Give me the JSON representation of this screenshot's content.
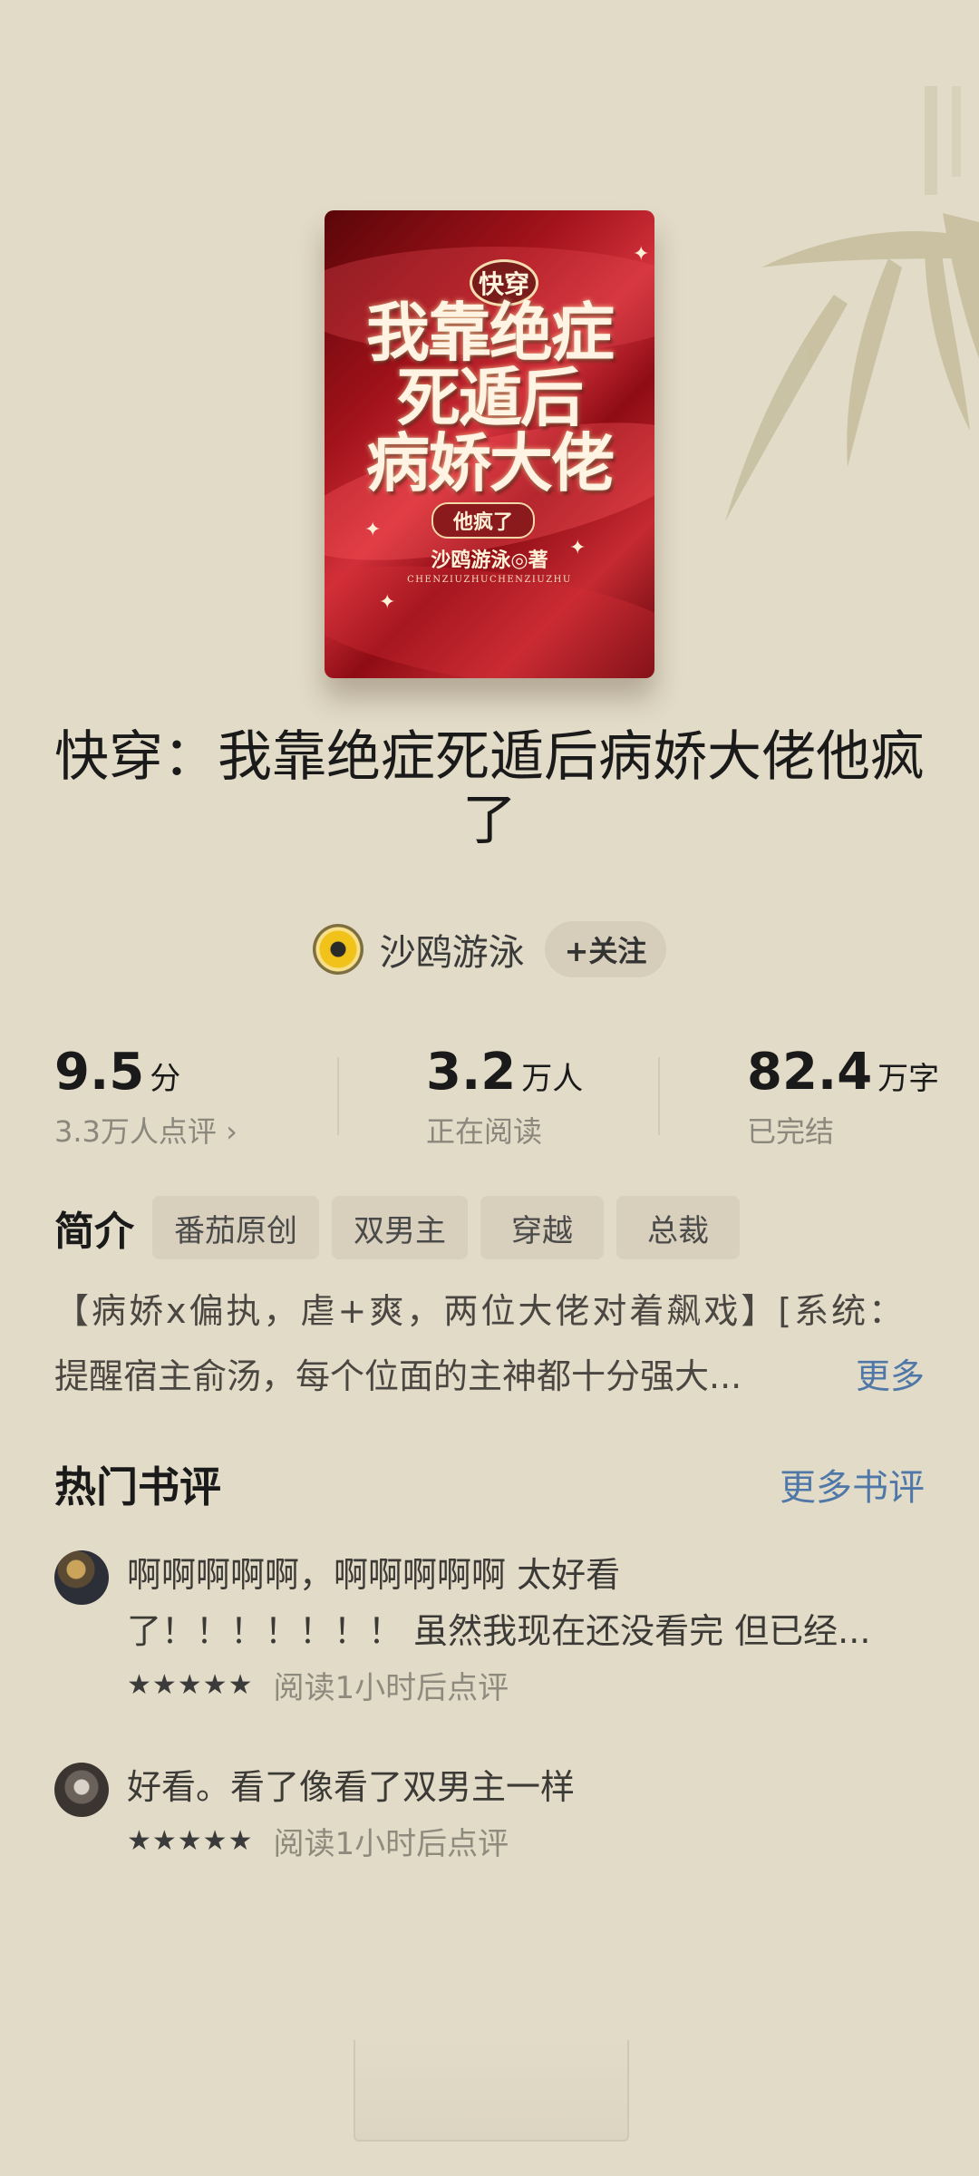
{
  "cover": {
    "tag": "快穿",
    "lines": [
      "我靠绝症",
      "死遁后",
      "病娇大佬"
    ],
    "sub": "他疯了",
    "author": "沙鸥游泳◎著",
    "pinyin": "CHENZIUZHUCHENZIUZHU"
  },
  "book": {
    "title": "快穿：我靠绝症死遁后病娇大佬他疯了"
  },
  "author": {
    "name": "沙鸥游泳",
    "follow_label": "+关注"
  },
  "stats": {
    "score": "9.5",
    "score_unit": "分",
    "score_sub": "3.3万人点评 ›",
    "readers": "3.2",
    "readers_unit": "万人",
    "readers_sub": "正在阅读",
    "words": "82.4",
    "words_unit": "万字",
    "words_sub": "已完结"
  },
  "intro": {
    "label": "简介",
    "tags": [
      "番茄原创",
      "双男主",
      "穿越",
      "总裁"
    ],
    "line1": "【病娇x偏执，虐+爽，两位大佬对着飙戏】[系统：",
    "line2": "提醒宿主俞汤，每个位面的主神都十分强大...",
    "more": "更多"
  },
  "reviews": {
    "title": "热门书评",
    "more": "更多书评",
    "items": [
      {
        "line1": "啊啊啊啊啊，啊啊啊啊啊 太好看",
        "line2": "了！！！！！！！ 虽然我现在还没看完 但已经...",
        "stars": "★★★★★",
        "time": "阅读1小时后点评",
        "rating": 5
      },
      {
        "line1": "好看。看了像看了双男主一样",
        "stars": "★★★★★",
        "time": "阅读1小时后点评",
        "rating": 5
      }
    ]
  },
  "colors": {
    "background": "#e2dbc7",
    "link": "#4f78a8",
    "cover_red": "#a1121a"
  }
}
